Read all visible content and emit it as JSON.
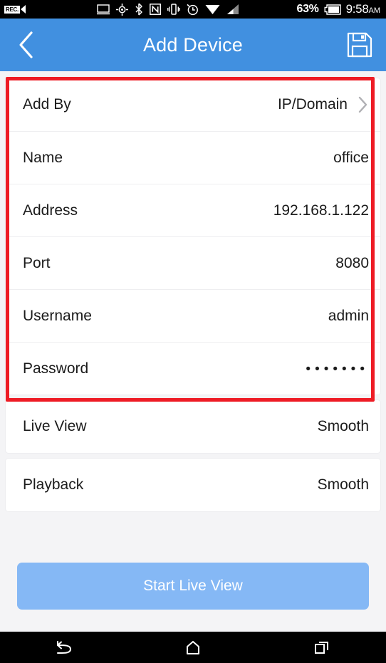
{
  "status_bar": {
    "recording_label": "REC.",
    "battery_percent": "63%",
    "time": "9:58",
    "time_period": "AM",
    "icons": [
      "rec-icon",
      "screencast-icon",
      "gps-icon",
      "bluetooth-icon",
      "nfc-icon",
      "vibrate-icon",
      "alarm-icon",
      "wifi-icon",
      "cellular-signal-icon",
      "battery-icon"
    ]
  },
  "app_bar": {
    "title": "Add Device",
    "back_icon": "chevron-left-icon",
    "save_icon": "floppy-disk-save-icon"
  },
  "form": {
    "rows": [
      {
        "label": "Add By",
        "value": "IP/Domain",
        "has_chevron": true
      },
      {
        "label": "Name",
        "value": "office",
        "has_chevron": false
      },
      {
        "label": "Address",
        "value": "192.168.1.122",
        "has_chevron": false
      },
      {
        "label": "Port",
        "value": "8080",
        "has_chevron": false
      },
      {
        "label": "Username",
        "value": "admin",
        "has_chevron": false
      },
      {
        "label": "Password",
        "value": "•••••••",
        "has_chevron": false
      }
    ]
  },
  "stream_settings": {
    "live_view": {
      "label": "Live View",
      "value": "Smooth"
    },
    "playback": {
      "label": "Playback",
      "value": "Smooth"
    }
  },
  "primary_action": {
    "label": "Start Live View"
  },
  "annotation": {
    "highlight_color": "#ee1c25"
  },
  "nav_bar": {
    "back_icon": "back-arrow-icon",
    "home_icon": "home-icon",
    "recents_icon": "recents-icon"
  },
  "colors": {
    "app_bar": "#4190e0",
    "page_background": "#f4f4f6",
    "card": "#ffffff",
    "primary_button": "#85b8f5",
    "text": "#1b1b1b"
  }
}
